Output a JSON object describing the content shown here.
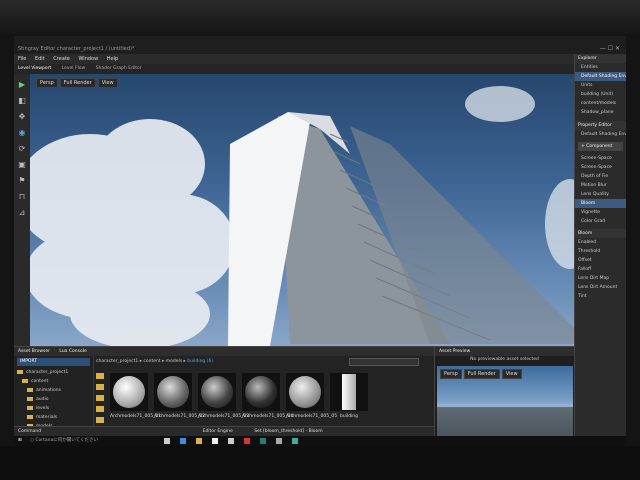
{
  "window": {
    "title": "Stingray Editor character_project1 / (untitled)*"
  },
  "menu": [
    "File",
    "Edit",
    "Create",
    "Window",
    "Help"
  ],
  "viewport_tabs": [
    "Level Viewport",
    "Level Flow",
    "Shader Graph Editor"
  ],
  "viewport_buttons": [
    "Persp",
    "Full Render",
    "View"
  ],
  "explorer": {
    "title": "Explorer",
    "items": [
      "Entities",
      "Default Shading Environment",
      "Units",
      "building (Unit)",
      "content/models",
      "Shadow_plane"
    ]
  },
  "property_editor": {
    "title": "Property Editor",
    "subtitle": "Default Shading Environment",
    "add_button": "+ Component",
    "components": [
      "Screen-Space",
      "Screen-Space",
      "Depth of Fie",
      "Motion Blur",
      "Lens Quality",
      "Bloom",
      "Vignette",
      "Color Grad"
    ],
    "selected_component": "Bloom",
    "section": "Bloom",
    "props": [
      "Enabled",
      "Threshold",
      "Offset",
      "Falloff",
      "Lens Dirt Map",
      "Lens Dirt Amount",
      "Tint"
    ]
  },
  "asset_browser": {
    "tabs": [
      "Asset Browser",
      "Lua Console"
    ],
    "import_button": "IMPORT",
    "tree": [
      "character_project1",
      "content",
      "animations",
      "audio",
      "levels",
      "materials",
      "models",
      "building"
    ],
    "path": [
      "character_project1",
      "content",
      "models",
      "building (6)"
    ],
    "search_placeholder": "",
    "thumbnails": [
      {
        "label": "Archmodels71_005_01"
      },
      {
        "label": "Archmodels71_005_02"
      },
      {
        "label": "Archmodels71_005_03"
      },
      {
        "label": "Archmodels71_005_04"
      },
      {
        "label": "Archmodels71_005_05"
      },
      {
        "label": "building"
      }
    ]
  },
  "asset_preview": {
    "title": "Asset Preview",
    "message": "No previewable asset selected",
    "buttons": [
      "Persp",
      "Full Render",
      "View"
    ]
  },
  "console": {
    "label": "Command",
    "engine": "Editor Engine",
    "status": "Set [bloom_threshold] - Bloom"
  },
  "taskbar": {
    "cortana": "Cortanaに何か聞いてください"
  },
  "colors": {
    "accent": "#3d5a80",
    "folder": "#d9b24a",
    "link": "#5ea0e0"
  }
}
